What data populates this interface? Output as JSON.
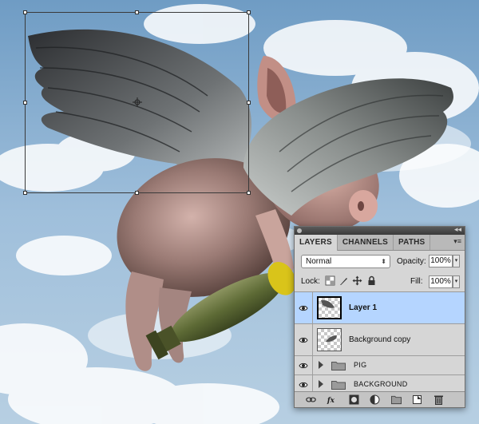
{
  "layers_panel": {
    "tabs": [
      {
        "label": "LAYERS",
        "active": true
      },
      {
        "label": "CHANNELS",
        "active": false
      },
      {
        "label": "PATHS",
        "active": false
      }
    ],
    "blend_mode": "Normal",
    "opacity_label": "Opacity:",
    "opacity_value": "100%",
    "lock_label": "Lock:",
    "fill_label": "Fill:",
    "fill_value": "100%",
    "layers": [
      {
        "name": "Layer 1",
        "selected": true,
        "visible": true
      },
      {
        "name": "Background copy",
        "selected": false,
        "visible": true
      }
    ],
    "groups": [
      {
        "name": "PIG",
        "visible": true
      },
      {
        "name": "BACKGROUND",
        "visible": true
      }
    ],
    "bottom_icons": [
      "link-icon",
      "fx-icon",
      "mask-icon",
      "adjustment-icon",
      "group-folder-icon",
      "new-layer-icon",
      "trash-icon"
    ]
  },
  "colors": {
    "sky": "#8fb3d0",
    "panel_bg": "#d6d6d6",
    "selection": "#b5d5ff"
  }
}
